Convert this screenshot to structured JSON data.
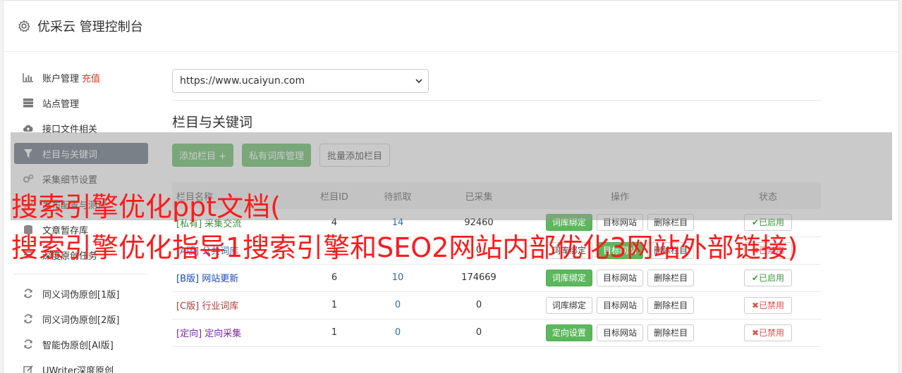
{
  "header": {
    "title": "优采云 管理控制台",
    "icon": "gear-icon"
  },
  "sidebar": {
    "items": [
      {
        "label": "账户管理",
        "extra": "充值",
        "icon": "bar-chart-icon"
      },
      {
        "label": "站点管理",
        "icon": "server-icon"
      },
      {
        "label": "接口文件相关",
        "icon": "cloud-upload-icon"
      },
      {
        "label": "栏目与关键词",
        "icon": "filter-icon",
        "active": true
      },
      {
        "label": "采集细节设置",
        "icon": "cogs-icon"
      },
      {
        "label": "发布配置与测试",
        "icon": "wrench-icon"
      },
      {
        "label": "文章暂存库",
        "icon": "database-icon"
      },
      {
        "label": "深度原创任务",
        "icon": "tasks-icon"
      }
    ],
    "items2": [
      {
        "label": "同义词伪原创[1版]",
        "icon": "refresh-icon"
      },
      {
        "label": "同义词伪原创[2版]",
        "icon": "refresh-icon"
      },
      {
        "label": "智能伪原创[AI版]",
        "icon": "refresh-icon"
      },
      {
        "label": "UWriter深度原创",
        "icon": "edit-icon"
      }
    ]
  },
  "site_select": {
    "value": "https://www.ucaiyun.com"
  },
  "section": {
    "title": "栏目与关键词"
  },
  "toolbar": {
    "add": "添加栏目 +",
    "private": "私有词库管理",
    "batch": "批量添加栏目"
  },
  "table": {
    "headers": {
      "name": "栏目名称",
      "id": "栏目ID",
      "pending": "待抓取",
      "collected": "已采集",
      "ops": "操作",
      "status": "状态"
    },
    "rows": [
      {
        "tag": "[私有]",
        "name": "采集交流",
        "id": "4",
        "pending": "14",
        "collected": "92460",
        "op1": "词库绑定",
        "op2": "目标网站",
        "op3": "删除栏目",
        "status": "✔已启用"
      },
      {
        "tag": "[A版]",
        "name": "公共词库",
        "id": "1",
        "pending": "1",
        "collected": "0",
        "op1": "词库绑定",
        "op2": "目标网站",
        "op3": "删除栏目",
        "status": "✖已禁用"
      },
      {
        "tag": "[B版]",
        "name": "网站更新",
        "id": "6",
        "pending": "10",
        "collected": "174669",
        "op1": "词库绑定",
        "op2": "目标网站",
        "op3": "删除栏目",
        "status": "✔已启用"
      },
      {
        "tag": "[C版]",
        "name": "行业词库",
        "id": "1",
        "pending": "0",
        "collected": "0",
        "op1": "词库绑定",
        "op2": "目标网站",
        "op3": "删除栏目",
        "status": "✖已禁用"
      },
      {
        "tag": "[定向]",
        "name": "定向采集",
        "id": "1",
        "pending": "0",
        "collected": "0",
        "op1": "定向设置",
        "op2": "目标网站",
        "op3": "删除栏目",
        "status": "✖已禁用"
      }
    ]
  },
  "overlay_text": {
    "line1": "搜索引擎优化ppt文档(",
    "line2": "搜索引擎优化指导1搜索引擎和SEO2网站内部优化3网站外部链接)"
  },
  "colors": {
    "accent_green": "#5cb85c",
    "sidebar_active": "#5d6a7a",
    "overlay_red": "#ff1a1a"
  }
}
